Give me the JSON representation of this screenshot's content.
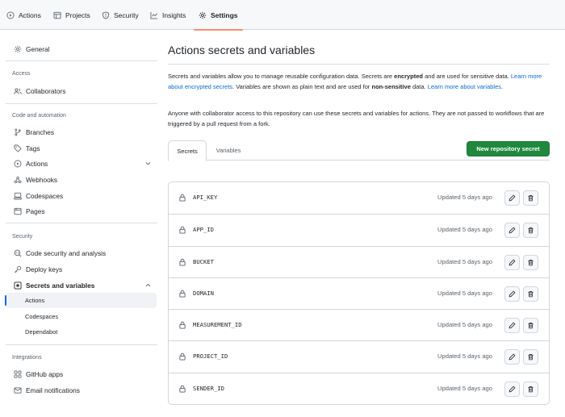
{
  "topnav": {
    "tabs": [
      {
        "label": "Actions",
        "icon": "play-icon"
      },
      {
        "label": "Projects",
        "icon": "table-icon"
      },
      {
        "label": "Security",
        "icon": "shield-icon"
      },
      {
        "label": "Insights",
        "icon": "graph-icon"
      },
      {
        "label": "Settings",
        "icon": "gear-icon",
        "active": true
      }
    ]
  },
  "sidebar": {
    "general": "General",
    "access_header": "Access",
    "collaborators": "Collaborators",
    "code_header": "Code and automation",
    "branches": "Branches",
    "tags": "Tags",
    "actions": "Actions",
    "webhooks": "Webhooks",
    "codespaces": "Codespaces",
    "pages": "Pages",
    "security_header": "Security",
    "code_security": "Code security and analysis",
    "deploy_keys": "Deploy keys",
    "secrets_vars": "Secrets and variables",
    "sub_actions": "Actions",
    "sub_codespaces": "Codespaces",
    "sub_dependabot": "Dependabot",
    "integrations_header": "Integrations",
    "github_apps": "GitHub apps",
    "email_notifications": "Email notifications"
  },
  "main": {
    "title": "Actions secrets and variables",
    "desc1_a": "Secrets and variables allow you to manage reusable configuration data. Secrets are ",
    "desc1_b": "encrypted",
    "desc1_c": " and are used for sensitive data. ",
    "desc1_link1": "Learn more about encrypted secrets",
    "desc1_d": ". Variables are shown as plain text and are used for ",
    "desc1_e": "non-sensitive",
    "desc1_f": " data. ",
    "desc1_link2": "Learn more about variables",
    "desc1_g": ".",
    "desc2": "Anyone with collaborator access to this repository can use these secrets and variables for actions. They are not passed to workflows that are triggered by a pull request from a fork.",
    "tab_secrets": "Secrets",
    "tab_variables": "Variables",
    "new_secret_button": "New repository secret",
    "secrets": [
      {
        "name": "API_KEY",
        "updated": "Updated 5 days ago"
      },
      {
        "name": "APP_ID",
        "updated": "Updated 5 days ago"
      },
      {
        "name": "BUCKET",
        "updated": "Updated 5 days ago"
      },
      {
        "name": "DOMAIN",
        "updated": "Updated 5 days ago"
      },
      {
        "name": "MEASUREMENT_ID",
        "updated": "Updated 5 days ago"
      },
      {
        "name": "PROJECT_ID",
        "updated": "Updated 5 days ago"
      },
      {
        "name": "SENDER_ID",
        "updated": "Updated 5 days ago"
      }
    ]
  },
  "colors": {
    "accent_link": "#0969da",
    "primary_button": "#1f883d",
    "active_tab_underline": "#fd8c73",
    "border": "#d0d7de"
  }
}
